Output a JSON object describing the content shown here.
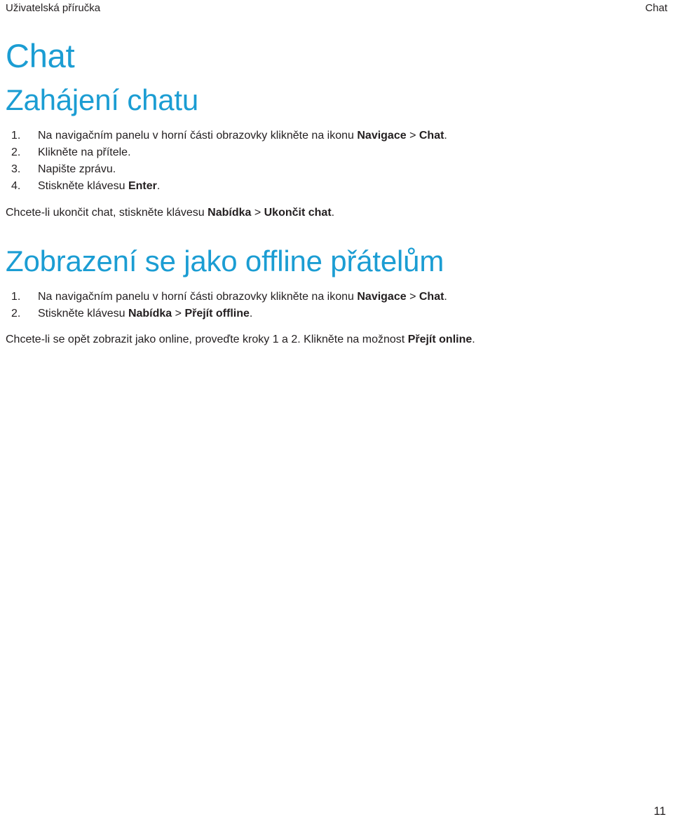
{
  "theme": {
    "accent_blue": "#1b9dd3",
    "body_text": "#231f20",
    "background": "#ffffff"
  },
  "running_header": {
    "left": "Uživatelská příručka",
    "right": "Chat"
  },
  "document": {
    "title": "Chat"
  },
  "sections": [
    {
      "heading": "Zahájení chatu",
      "steps": [
        {
          "parts": [
            {
              "text": "Na navigačním panelu v horní části obrazovky klikněte na ikonu ",
              "bold": false
            },
            {
              "text": "Navigace",
              "bold": true
            },
            {
              "text": " > ",
              "bold": false
            },
            {
              "text": "Chat",
              "bold": true
            },
            {
              "text": ".",
              "bold": false
            }
          ]
        },
        {
          "parts": [
            {
              "text": "Klikněte na přítele.",
              "bold": false
            }
          ]
        },
        {
          "parts": [
            {
              "text": "Napište zprávu.",
              "bold": false
            }
          ]
        },
        {
          "parts": [
            {
              "text": "Stiskněte klávesu ",
              "bold": false
            },
            {
              "text": "Enter",
              "bold": true
            },
            {
              "text": ".",
              "bold": false
            }
          ]
        }
      ],
      "note": {
        "parts": [
          {
            "text": "Chcete-li ukončit chat, stiskněte klávesu ",
            "bold": false
          },
          {
            "text": "Nabídka",
            "bold": true
          },
          {
            "text": " > ",
            "bold": false
          },
          {
            "text": "Ukončit chat",
            "bold": true
          },
          {
            "text": ".",
            "bold": false
          }
        ]
      }
    },
    {
      "heading": "Zobrazení se jako offline přátelům",
      "steps": [
        {
          "parts": [
            {
              "text": "Na navigačním panelu v horní části obrazovky klikněte na ikonu ",
              "bold": false
            },
            {
              "text": "Navigace",
              "bold": true
            },
            {
              "text": " > ",
              "bold": false
            },
            {
              "text": "Chat",
              "bold": true
            },
            {
              "text": ".",
              "bold": false
            }
          ]
        },
        {
          "parts": [
            {
              "text": "Stiskněte klávesu ",
              "bold": false
            },
            {
              "text": "Nabídka",
              "bold": true
            },
            {
              "text": " > ",
              "bold": false
            },
            {
              "text": "Přejít offline",
              "bold": true
            },
            {
              "text": ".",
              "bold": false
            }
          ]
        }
      ],
      "note": {
        "parts": [
          {
            "text": "Chcete-li se opět zobrazit jako online, proveďte kroky 1 a 2. Klikněte na možnost ",
            "bold": false
          },
          {
            "text": "Přejít online",
            "bold": true
          },
          {
            "text": ".",
            "bold": false
          }
        ]
      }
    }
  ],
  "footer": {
    "page_number": "11"
  }
}
